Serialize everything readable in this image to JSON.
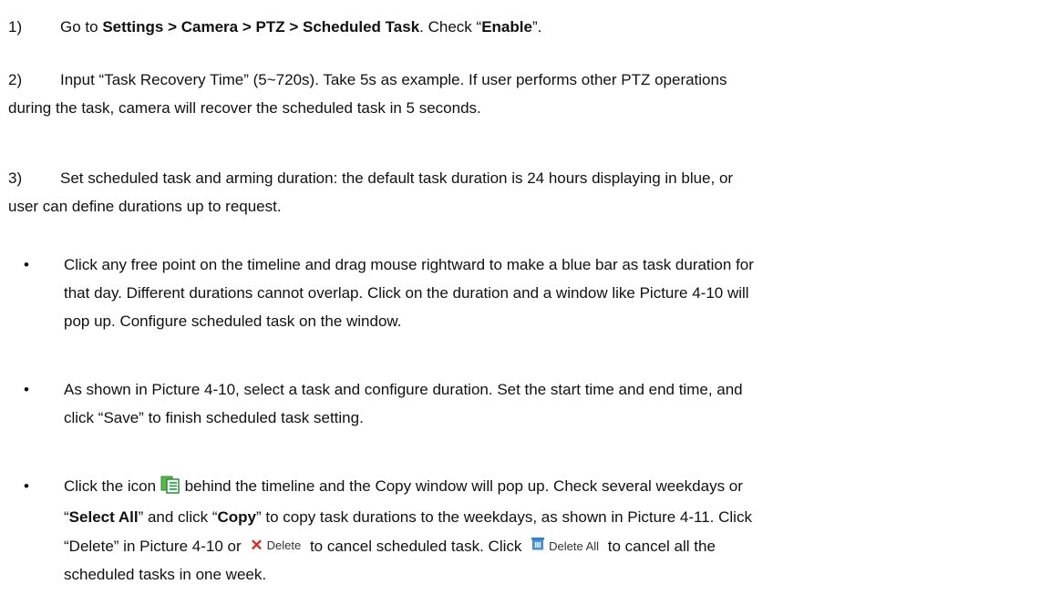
{
  "steps": [
    {
      "num": "1)",
      "a": "Go to ",
      "path": "Settings > Camera > PTZ > Scheduled Task",
      "b": ". Check “",
      "enable": "Enable",
      "c": "”."
    },
    {
      "num": "2)",
      "line1": "Input “Task Recovery Time” (5~720s). Take 5s as example. If user performs other PTZ operations",
      "line2": "during the task, camera will recover the scheduled task in 5 seconds."
    },
    {
      "num": "3)",
      "line1": "Set scheduled task and arming duration: the default task duration is 24 hours displaying in blue, or",
      "line2": "user can define durations up to request."
    }
  ],
  "bullets": [
    {
      "symbol": "•",
      "lines": [
        "Click any free point on the timeline and drag mouse rightward to make a blue bar as task duration for",
        "that day. Different durations cannot overlap. Click on the duration and a window like Picture 4-10 will",
        "pop up. Configure scheduled task on the window."
      ]
    },
    {
      "symbol": "•",
      "lines": [
        "As shown in Picture 4-10, select a task and configure duration. Set the start time and end time, and",
        "click “Save” to finish scheduled task setting."
      ]
    },
    {
      "symbol": "•",
      "l1a": "Click the icon",
      "l1b": "behind the timeline and the Copy window will pop up. Check several weekdays or",
      "l2a": "“",
      "select_all": "Select All",
      "l2b": "” and click “",
      "copy": "Copy",
      "l2c": "” to copy task durations to the weekdays, as shown in Picture 4-11. Click",
      "l3a": "“Delete” in Picture 4-10 or",
      "delete_label": "Delete",
      "l3b": "to cancel scheduled task. Click",
      "delete_all_label": "Delete All",
      "l3c": "to cancel all the",
      "line4": "scheduled tasks in one week."
    }
  ],
  "icons": {
    "copy_icon_color": "#2fa84f",
    "delete_icon_color": "#e1261c",
    "delete_all_icon_color": "#2f7fd0"
  }
}
